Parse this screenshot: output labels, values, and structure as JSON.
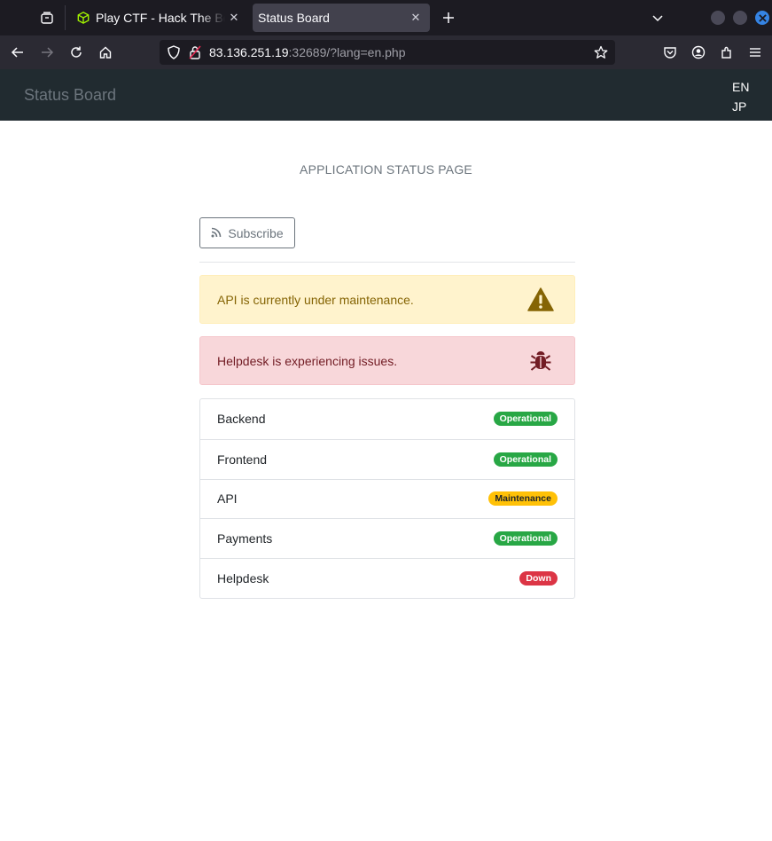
{
  "browser": {
    "tabs": [
      {
        "title": "Play CTF - Hack The Box CTF Platform",
        "active": false
      },
      {
        "title": "Status Board",
        "active": true
      }
    ],
    "url": {
      "host": "83.136.251.19",
      "rest": ":32689/?lang=en.php"
    }
  },
  "site": {
    "brand": "Status Board",
    "languages": [
      "EN",
      "JP"
    ],
    "heading": "APPLICATION STATUS PAGE",
    "subscribe_label": "Subscribe",
    "alerts": [
      {
        "type": "warning",
        "text": "API is currently under maintenance.",
        "icon": "warning-triangle-icon"
      },
      {
        "type": "danger",
        "text": "Helpdesk is experiencing issues.",
        "icon": "bug-icon"
      }
    ],
    "services": [
      {
        "name": "Backend",
        "status": "Operational",
        "color": "#28a745"
      },
      {
        "name": "Frontend",
        "status": "Operational",
        "color": "#28a745"
      },
      {
        "name": "API",
        "status": "Maintenance",
        "color": "#ffc107"
      },
      {
        "name": "Payments",
        "status": "Operational",
        "color": "#28a745"
      },
      {
        "name": "Helpdesk",
        "status": "Down",
        "color": "#dc3545"
      }
    ]
  },
  "colors": {
    "navbar": "#212b30",
    "warning_bg": "#fff3cd",
    "danger_bg": "#f8d7da",
    "success": "#28a745",
    "maintenance": "#ffc107",
    "down": "#dc3545"
  }
}
